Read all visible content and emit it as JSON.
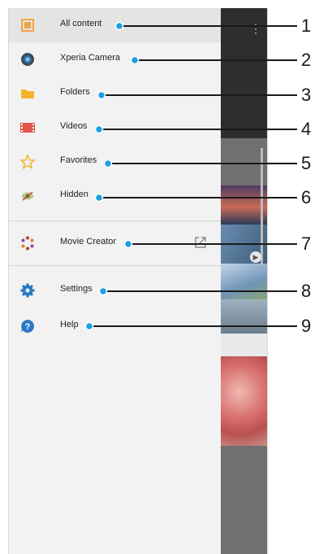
{
  "menu": {
    "items": [
      {
        "label": "All content",
        "icon": "all-content-icon",
        "color": "#f2a544"
      },
      {
        "label": "Xperia Camera",
        "icon": "camera-icon",
        "color": "#2f5f8f"
      },
      {
        "label": "Folders",
        "icon": "folder-icon",
        "color": "#f5b428"
      },
      {
        "label": "Videos",
        "icon": "video-icon",
        "color": "#e0574a"
      },
      {
        "label": "Favorites",
        "icon": "star-icon",
        "color": "#f5b428"
      },
      {
        "label": "Hidden",
        "icon": "hidden-icon",
        "color": "#7a8f3a"
      },
      {
        "label": "Movie Creator",
        "icon": "movie-creator-icon",
        "color": "#c0392b"
      },
      {
        "label": "Settings",
        "icon": "gear-icon",
        "color": "#2a79c3"
      },
      {
        "label": "Help",
        "icon": "help-icon",
        "color": "#2a79c3"
      }
    ]
  },
  "callouts": {
    "numbers": [
      "1",
      "2",
      "3",
      "4",
      "5",
      "6",
      "7",
      "8",
      "9"
    ],
    "color": "#1ba1e2"
  },
  "background": {
    "topbar_color": "#2e2e2e",
    "app_color": "#707070"
  }
}
